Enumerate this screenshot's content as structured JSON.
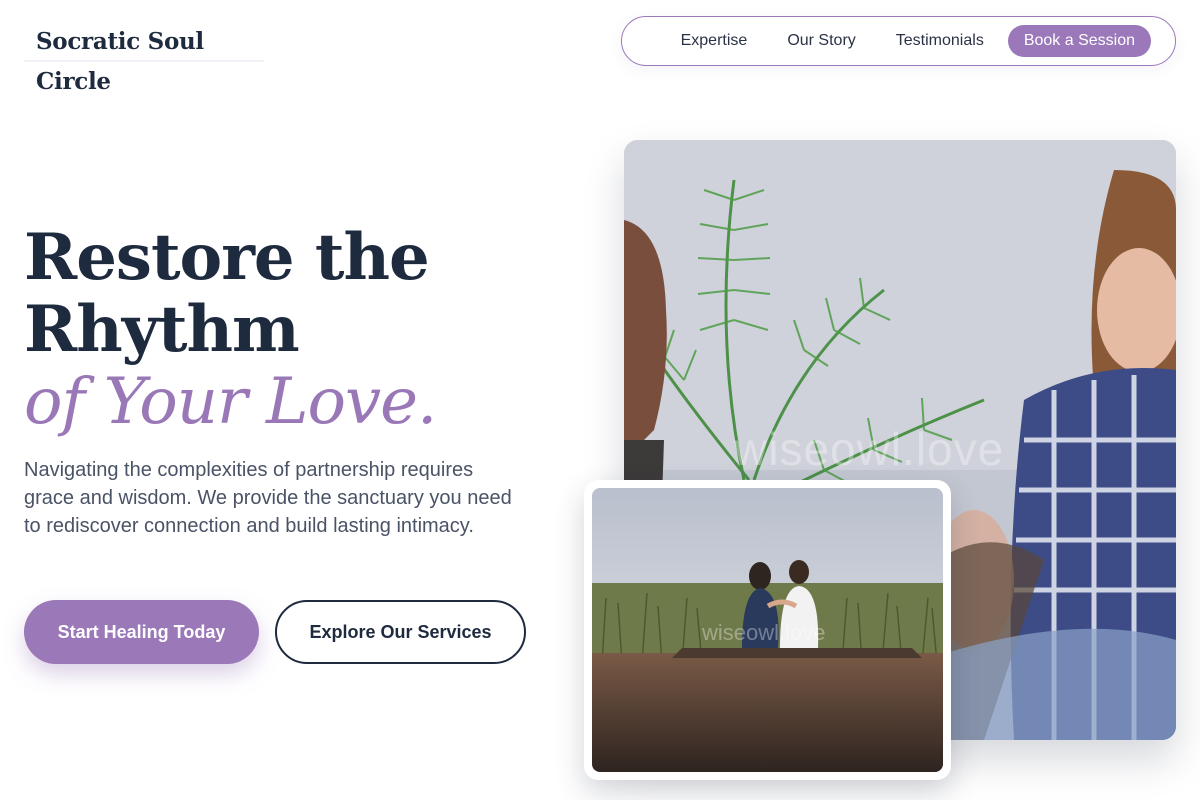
{
  "brand": {
    "name": "Socratic Soul Circle"
  },
  "nav": {
    "links": [
      "Expertise",
      "Our Story",
      "Testimonials"
    ],
    "cta": "Book a Session"
  },
  "hero": {
    "headline_line1": "Restore the",
    "headline_line2": "Rhythm",
    "headline_accent": "of Your Love.",
    "lede": "Navigating the complexities of partnership requires grace and wisdom. We provide the sanctuary you need to rediscover connection and build lasting intimacy.",
    "primary_cta": "Start Healing Today",
    "secondary_cta": "Explore Our Services"
  },
  "images": {
    "main_watermark": "wiseowl.love",
    "small_watermark": "wiseowl.love"
  },
  "colors": {
    "accent": "#9b78b8",
    "navy": "#1e2a3e",
    "body_text": "#4a5366"
  }
}
